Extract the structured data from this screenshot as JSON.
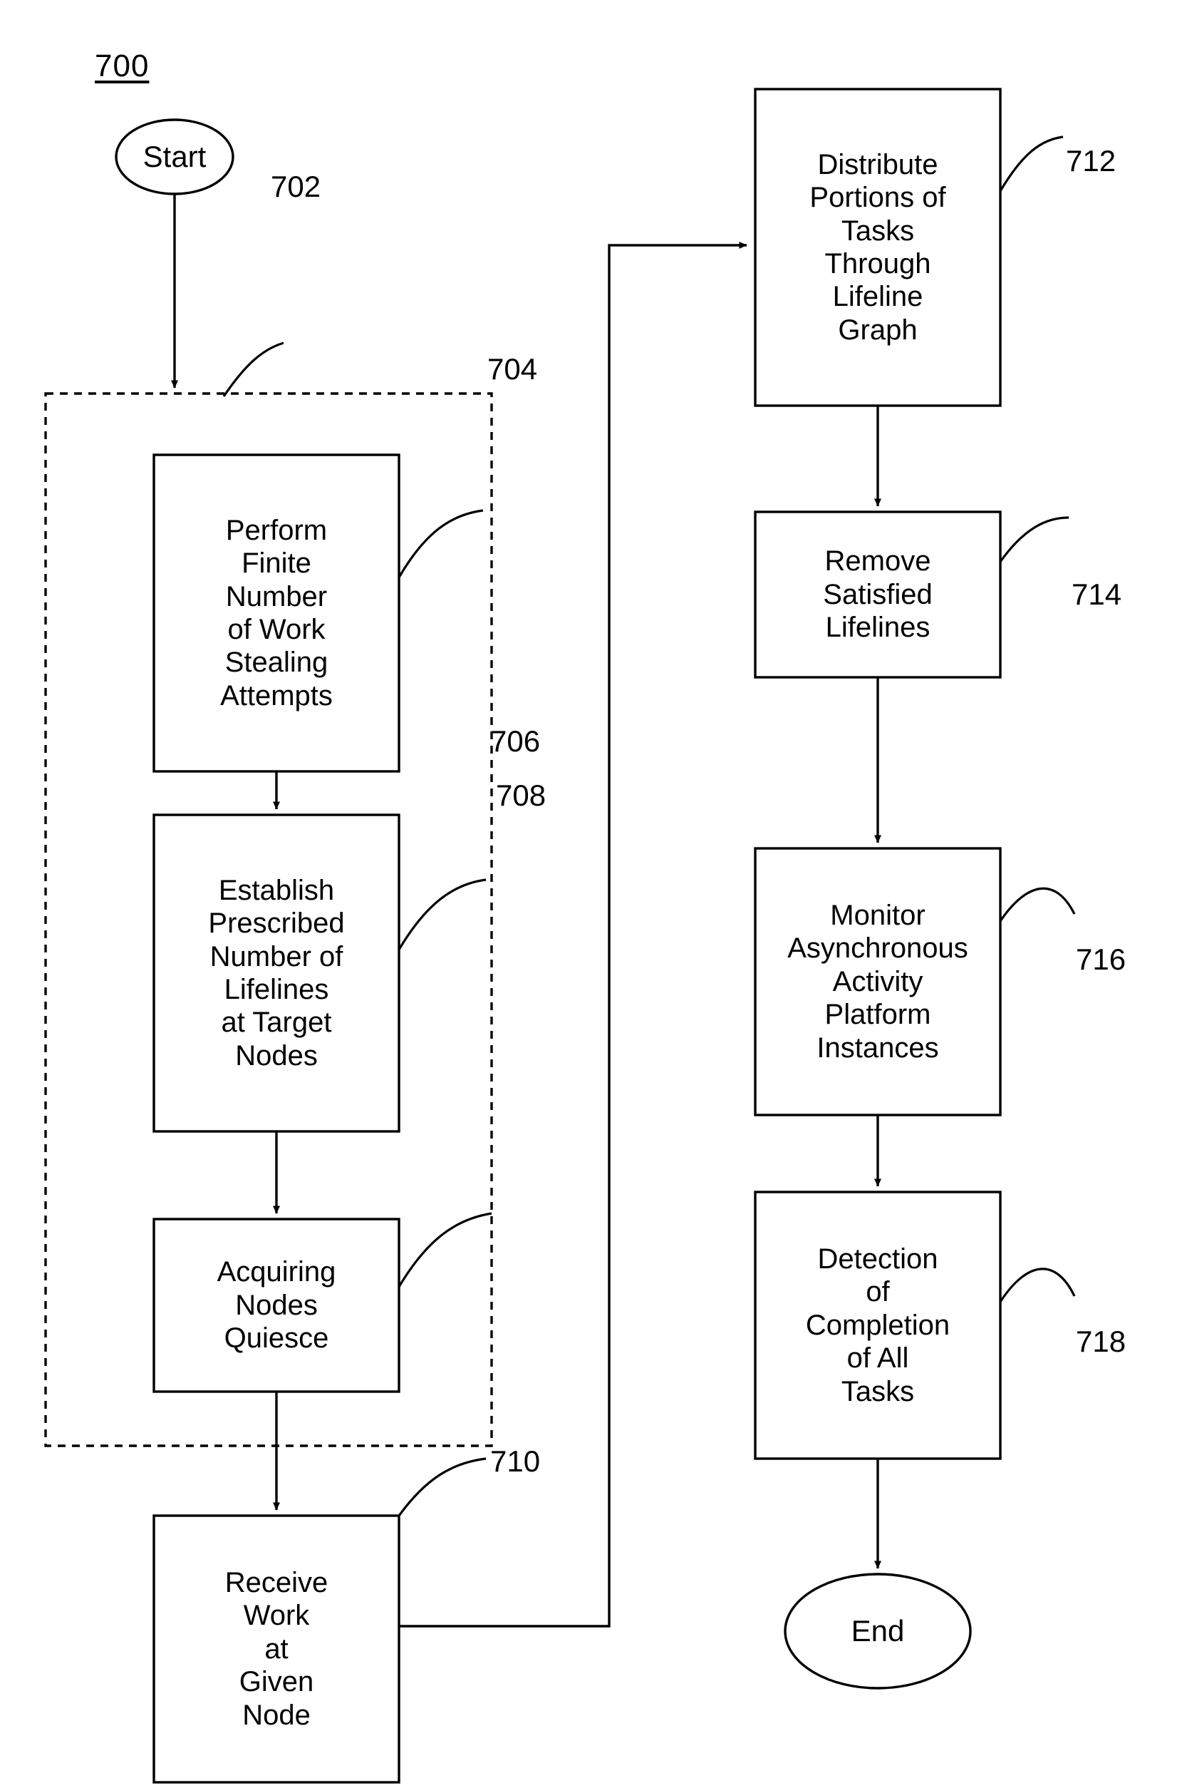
{
  "figure": {
    "number": "700",
    "type": "flowchart"
  },
  "chart_data": {
    "type": "diagram",
    "title": "700",
    "diagram_kind": "patent-flowchart",
    "nodes": [
      {
        "id": "start",
        "shape": "ellipse",
        "label": "Start",
        "lines": [
          "Start"
        ]
      },
      {
        "id": "704",
        "shape": "rectangle",
        "ref": "704",
        "lines": [
          "Perform",
          "Finite",
          "Number",
          "of Work",
          "Stealing",
          "Attempts"
        ]
      },
      {
        "id": "706",
        "shape": "rectangle",
        "ref": "706",
        "lines": [
          "Establish",
          "Prescribed",
          "Number of",
          "Lifelines",
          "at Target",
          "Nodes"
        ]
      },
      {
        "id": "708",
        "shape": "rectangle",
        "ref": "708",
        "lines": [
          "Acquiring",
          "Nodes",
          "Quiesce"
        ]
      },
      {
        "id": "710",
        "shape": "rectangle",
        "ref": "710",
        "lines": [
          "Receive",
          "Work",
          "at",
          "Given",
          "Node"
        ]
      },
      {
        "id": "712",
        "shape": "rectangle",
        "ref": "712",
        "lines": [
          "Distribute",
          "Portions of",
          "Tasks",
          "Through",
          "Lifeline",
          "Graph"
        ]
      },
      {
        "id": "714",
        "shape": "rectangle",
        "ref": "714",
        "lines": [
          "Remove",
          "Satisfied",
          "Lifelines"
        ]
      },
      {
        "id": "716",
        "shape": "rectangle",
        "ref": "716",
        "lines": [
          "Monitor",
          "Asynchronous",
          "Activity",
          "Platform",
          "Instances"
        ]
      },
      {
        "id": "718",
        "shape": "rectangle",
        "ref": "718",
        "lines": [
          "Detection",
          "of",
          "Completion",
          "of All",
          "Tasks"
        ]
      },
      {
        "id": "end",
        "shape": "ellipse",
        "label": "End",
        "lines": [
          "End"
        ]
      },
      {
        "id": "group",
        "shape": "dashed-rectangle",
        "ref": "702",
        "lines": []
      }
    ],
    "edges": [
      {
        "from": "start",
        "to": "704",
        "style": "solid-arrow"
      },
      {
        "from": "704",
        "to": "706",
        "style": "solid-arrow"
      },
      {
        "from": "706",
        "to": "708",
        "style": "solid-arrow"
      },
      {
        "from": "708",
        "to": "710",
        "style": "solid-arrow"
      },
      {
        "from": "710",
        "to": "712",
        "style": "solid-arrow-routed"
      },
      {
        "from": "712",
        "to": "714",
        "style": "solid-arrow"
      },
      {
        "from": "714",
        "to": "716",
        "style": "solid-arrow"
      },
      {
        "from": "716",
        "to": "718",
        "style": "solid-arrow"
      },
      {
        "from": "718",
        "to": "end",
        "style": "solid-arrow"
      }
    ],
    "reference_numerals": [
      "700",
      "702",
      "704",
      "706",
      "708",
      "710",
      "712",
      "714",
      "716",
      "718"
    ]
  },
  "terminators": {
    "start": "Start",
    "end": "End"
  },
  "boxes": {
    "b704": {
      "ref": "704",
      "l1": "Perform",
      "l2": "Finite",
      "l3": "Number",
      "l4": "of Work",
      "l5": "Stealing",
      "l6": "Attempts"
    },
    "b706": {
      "ref": "706",
      "l1": "Establish",
      "l2": "Prescribed",
      "l3": "Number of",
      "l4": "Lifelines",
      "l5": "at Target",
      "l6": "Nodes"
    },
    "b708": {
      "ref": "708",
      "l1": "Acquiring",
      "l2": "Nodes",
      "l3": "Quiesce"
    },
    "b710": {
      "ref": "710",
      "l1": "Receive",
      "l2": "Work",
      "l3": "at",
      "l4": "Given",
      "l5": "Node"
    },
    "b712": {
      "ref": "712",
      "l1": "Distribute",
      "l2": "Portions of",
      "l3": "Tasks",
      "l4": "Through",
      "l5": "Lifeline",
      "l6": "Graph"
    },
    "b714": {
      "ref": "714",
      "l1": "Remove",
      "l2": "Satisfied",
      "l3": "Lifelines"
    },
    "b716": {
      "ref": "716",
      "l1": "Monitor",
      "l2": "Asynchronous",
      "l3": "Activity",
      "l4": "Platform",
      "l5": "Instances"
    },
    "b718": {
      "ref": "718",
      "l1": "Detection",
      "l2": "of",
      "l3": "Completion",
      "l4": "of All",
      "l5": "Tasks"
    }
  },
  "group": {
    "ref": "702"
  },
  "colors": {
    "stroke": "#000000",
    "background": "#ffffff",
    "text": "#000000"
  }
}
